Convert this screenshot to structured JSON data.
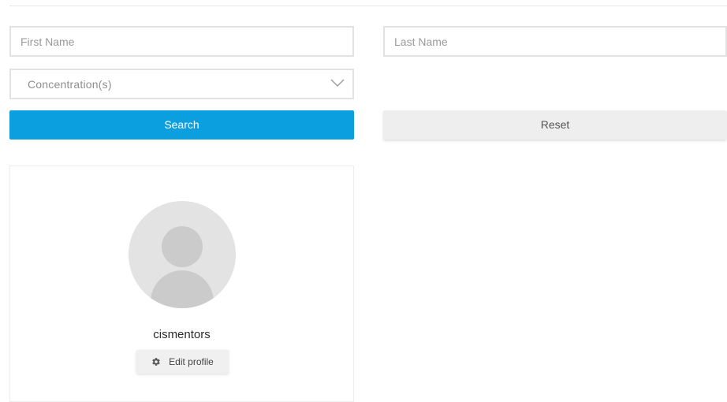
{
  "search_form": {
    "first_name": {
      "value": "",
      "placeholder": "First Name"
    },
    "last_name": {
      "value": "",
      "placeholder": "Last Name"
    },
    "concentration": {
      "placeholder": "Concentration(s)",
      "icon": "chevron-down-icon"
    },
    "search_label": "Search",
    "reset_label": "Reset"
  },
  "profile_card": {
    "avatar_icon": "user-avatar-icon",
    "username": "cismentors",
    "edit_label": "Edit profile",
    "edit_icon": "gear-icon"
  },
  "colors": {
    "primary": "#0b9fdf",
    "secondary_button": "#eeeeee",
    "border": "#e2e2e2",
    "avatar_bg": "#e3e3e3",
    "avatar_fg": "#cbcbcb"
  }
}
